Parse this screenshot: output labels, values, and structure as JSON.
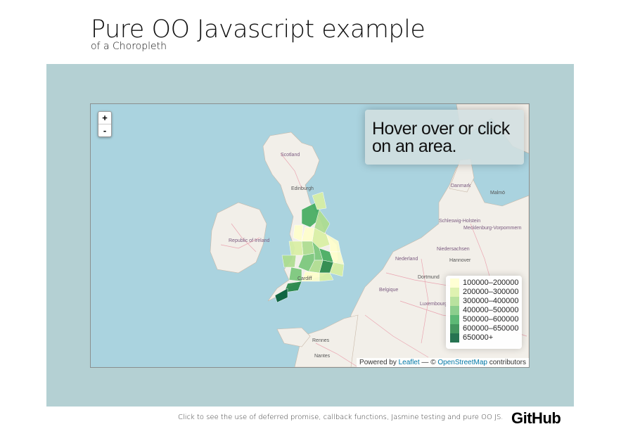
{
  "header": {
    "title": "Pure OO Javascript example",
    "subtitle": "of a Choropleth"
  },
  "map": {
    "zoom_in": "+",
    "zoom_out": "-",
    "info_text": "Hover over or click on an area.",
    "place_labels": [
      "Scotland",
      "Edinburgh",
      "Republic of Ireland",
      "Cardiff",
      "Danmark",
      "Malmö",
      "Hannover",
      "Dortmund",
      "Nederland",
      "Belgique",
      "Rennes",
      "Nantes",
      "Luxembourg",
      "Schleswig-Holstein",
      "Mecklenburg-Vorpommern",
      "Niedersachsen"
    ],
    "attribution": {
      "prefix": "Powered by",
      "leaflet": "Leaflet",
      "sep": " — © ",
      "osm": "OpenStreetMap",
      "suffix": " contributors"
    }
  },
  "legend": {
    "items": [
      {
        "label": "100000–200000",
        "color": "#ffffcc"
      },
      {
        "label": "200000–300000",
        "color": "#d9f0a3"
      },
      {
        "label": "300000–400000",
        "color": "#addd8e"
      },
      {
        "label": "400000–500000",
        "color": "#78c679"
      },
      {
        "label": "500000–600000",
        "color": "#41ab5d"
      },
      {
        "label": "600000–650000",
        "color": "#238443"
      },
      {
        "label": "650000+",
        "color": "#005a32"
      }
    ]
  },
  "footer": {
    "text": "Click to see the use of deferred promise, callback functions, Jasmine testing and pure OO JS.",
    "github": "GitHub"
  }
}
